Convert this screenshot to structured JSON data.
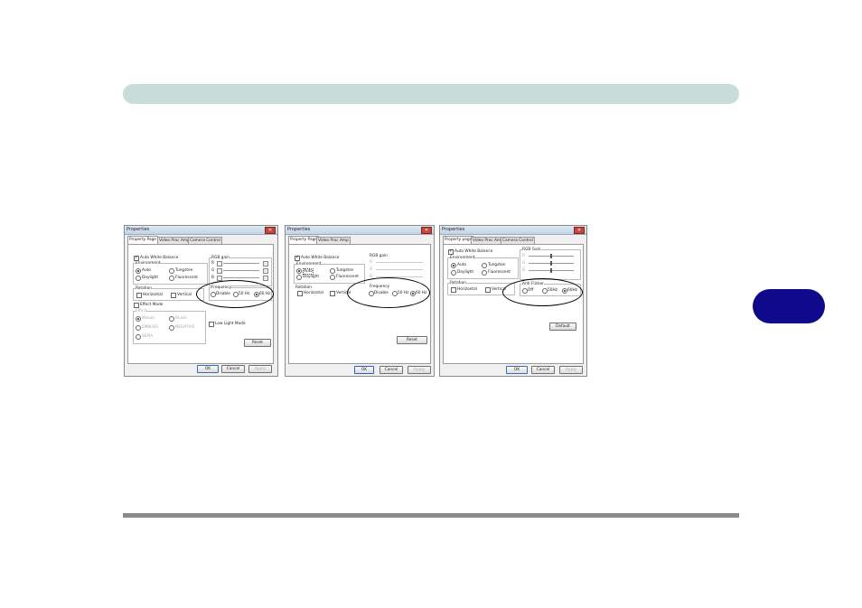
{
  "dialogs": [
    {
      "title": "Properties",
      "close_glyph": "✕",
      "tabs": [
        "Property Page",
        "Video Proc Amp",
        "Camera Control"
      ],
      "awb_label": "Auto White Balance",
      "env_label": "Environment",
      "env_options": [
        "Auto",
        "Tungsten",
        "Daylight",
        "Fluorescent"
      ],
      "rgb_label": "RGB gain",
      "rgb_channels": [
        "R",
        "G",
        "B"
      ],
      "rotation_label": "Rotation",
      "rotation_options": [
        "Horizontal",
        "Vertical"
      ],
      "freq_label": "Frequency",
      "freq_options": [
        "Disable",
        "50 Hz",
        "60 Hz"
      ],
      "effect_mode_label": "Effect Mode",
      "effect_label": "Effect",
      "effect_options": [
        "Mosaic",
        "Bluish",
        "EMBOSS",
        "NEGATIVE",
        "SEPIA"
      ],
      "lowlight_label": "Low Light Mode",
      "reset_label": "Reset",
      "ok": "OK",
      "cancel": "Cancel",
      "apply": "Apply"
    },
    {
      "title": "Properties",
      "close_glyph": "✕",
      "tabs": [
        "Property Page",
        "Video Proc Amp"
      ],
      "awb_label": "Auto White Balance",
      "env_label": "Environment",
      "env_options": [
        "Auto",
        "Tungsten",
        "Daylight",
        "Fluorescent"
      ],
      "rgb_label": "RGB gain",
      "rgb_channels": [
        "R",
        "G",
        "B"
      ],
      "rotation_label": "Rotation",
      "rotation_options": [
        "Horizontal",
        "Vertical"
      ],
      "freq_label": "Frequency",
      "freq_options": [
        "Disable",
        "50 Hz",
        "60 Hz"
      ],
      "reset_label": "Reset",
      "ok": "OK",
      "cancel": "Cancel",
      "apply": "Apply"
    },
    {
      "title": "Properties",
      "close_glyph": "✕",
      "tabs": [
        "Property page",
        "Video Proc Amp",
        "Camera Control"
      ],
      "awb_label": "Auto White Balance",
      "env_label": "Environment",
      "env_options": [
        "Auto",
        "Tungsten",
        "Daylight",
        "Fluorescent"
      ],
      "rgb_label": "RGB Gain",
      "rgb_channels": [
        "R",
        "G",
        "B"
      ],
      "rotation_label": "Rotation",
      "rotation_options": [
        "Horizontal",
        "Vertical"
      ],
      "freq_label": "Anti Flicker",
      "freq_options": [
        "Off",
        "50Hz",
        "60Hz"
      ],
      "default_label": "Default",
      "ok": "OK",
      "cancel": "Cancel",
      "apply": "Apply"
    }
  ],
  "colors": {
    "header_bar": "#c6ddd8",
    "side_tab": "#0f0a8c",
    "footer_rule": "#8a8a8a"
  }
}
